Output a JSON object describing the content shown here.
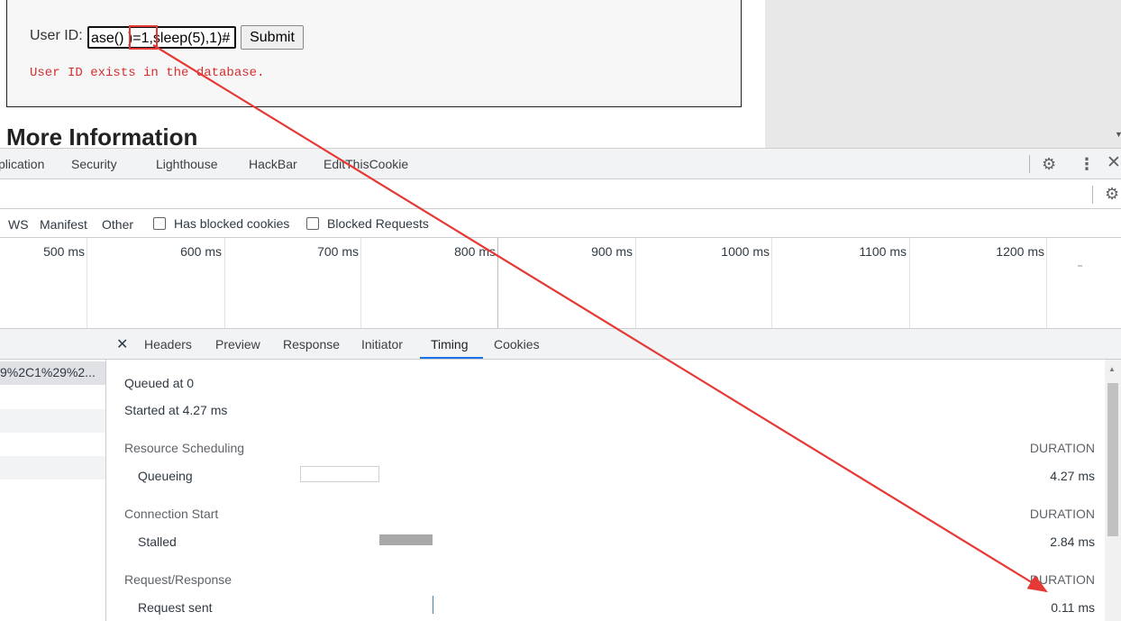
{
  "page": {
    "userid_label": "User ID:",
    "userid_value": "ase() )=1,sleep(5),1)#",
    "submit_label": "Submit",
    "result_message": "User ID exists in the database.",
    "more_info_heading": "More Information"
  },
  "devtools": {
    "tabs": [
      "plication",
      "Security",
      "Lighthouse",
      "HackBar",
      "EditThisCookie"
    ],
    "icons": {
      "settings": "gear-icon",
      "menu": "kebab-icon",
      "close": "close-icon"
    },
    "filters": {
      "types": [
        "WS",
        "Manifest",
        "Other"
      ],
      "checkboxes": [
        {
          "label": "Has blocked cookies",
          "checked": false
        },
        {
          "label": "Blocked Requests",
          "checked": false
        }
      ]
    },
    "overview_ticks": [
      "500 ms",
      "600 ms",
      "700 ms",
      "800 ms",
      "900 ms",
      "1000 ms",
      "1100 ms",
      "1200 ms"
    ],
    "request_list": {
      "rows": [
        "9%2C1%29%2..."
      ]
    },
    "detail_tabs": [
      "Headers",
      "Preview",
      "Response",
      "Initiator",
      "Timing",
      "Cookies"
    ],
    "active_detail_tab": "Timing",
    "timing": {
      "queued_at": "Queued at 0",
      "started_at": "Started at 4.27 ms",
      "sections": [
        {
          "title": "Resource Scheduling",
          "duration_header": "DURATION",
          "rows": [
            {
              "label": "Queueing",
              "value": "4.27 ms"
            }
          ]
        },
        {
          "title": "Connection Start",
          "duration_header": "DURATION",
          "rows": [
            {
              "label": "Stalled",
              "value": "2.84 ms"
            }
          ]
        },
        {
          "title": "Request/Response",
          "duration_header": "DURATION",
          "rows": [
            {
              "label": "Request sent",
              "value": "0.11 ms"
            }
          ]
        }
      ]
    }
  },
  "colors": {
    "annotation_red": "#e53935",
    "active_tab_blue": "#1a73e8",
    "error_text": "#d32f2f"
  }
}
